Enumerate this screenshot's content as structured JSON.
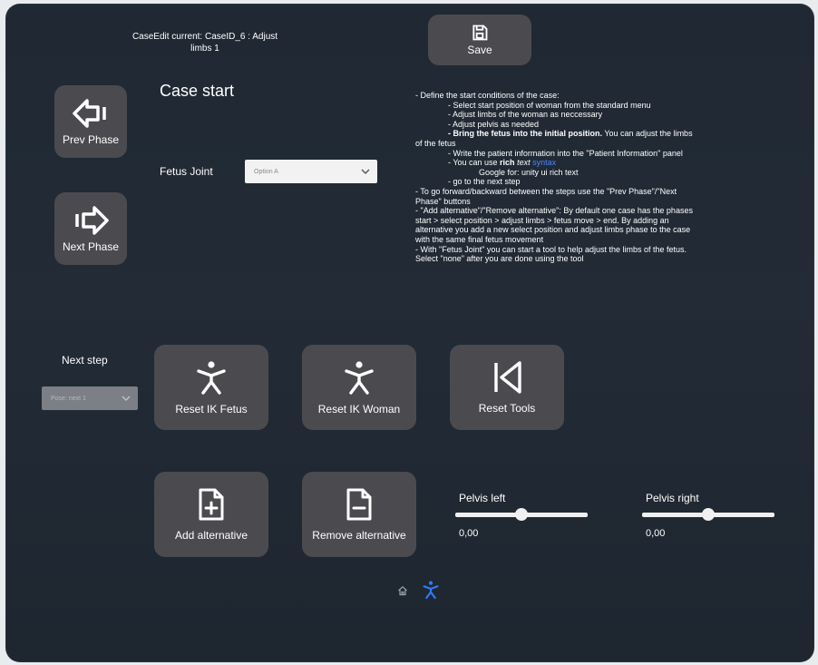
{
  "case_edit_line1": "CaseEdit current: CaseID_6 : Adjust",
  "case_edit_line2": "limbs 1",
  "save_label": "Save",
  "prev_phase_label": "Prev Phase",
  "next_phase_label": "Next Phase",
  "page_title": "Case start",
  "fetus_joint": {
    "label": "Fetus Joint",
    "selected": "Option A"
  },
  "next_step": {
    "label": "Next step",
    "selected": "Pose: next 1"
  },
  "instructions": {
    "l1": "- Define the start conditions of the case:",
    "l2": "- Select start position of woman from the standard menu",
    "l3": "- Adjust limbs of the woman as neccessary",
    "l4": "- Adjust pelvis as needed",
    "l5a": "- Bring the fetus into the initial position.",
    "l5b": " You can adjust the limbs",
    "l6": "of the fetus",
    "l7": "- Write the patient information into the \"Patient Information\" panel",
    "l8a": "- You can use ",
    "l8b": "rich",
    "l8c": " text",
    "l8d": "  syntax",
    "l9": "Google for: unity ui rich text",
    "l10": "- go to the next step",
    "l11": "- To go forward/backward between the steps use the \"Prev Phase\"/\"Next",
    "l12": "Phase\" buttons",
    "l13": "- \"Add alternative\"/\"Remove alternative\": By default one case has the phases",
    "l14": "start > select position > adjust limbs > fetus move > end. By adding an",
    "l15": "alternative you add a new select position and adjust limbs phase to the case",
    "l16": "with the same final fetus movement",
    "l17": "- With \"Fetus Joint\" you can start a tool to help adjust the limbs of the fetus.",
    "l18": "Select \"none\" after you are done using the tool"
  },
  "buttons": {
    "reset_ik_fetus": "Reset IK Fetus",
    "reset_ik_woman": "Reset IK Woman",
    "reset_tools": "Reset Tools",
    "add_alternative": "Add alternative",
    "remove_alternative": "Remove alternative"
  },
  "pelvis_left": {
    "label": "Pelvis left",
    "value": "0,00",
    "fraction": 0.5
  },
  "pelvis_right": {
    "label": "Pelvis right",
    "value": "0,00",
    "fraction": 0.5
  },
  "colors": {
    "button_bg": "#4b4b4f",
    "accent_icon": "#2f7bff"
  },
  "bottom_icons": [
    "home-icon",
    "person-icon"
  ]
}
